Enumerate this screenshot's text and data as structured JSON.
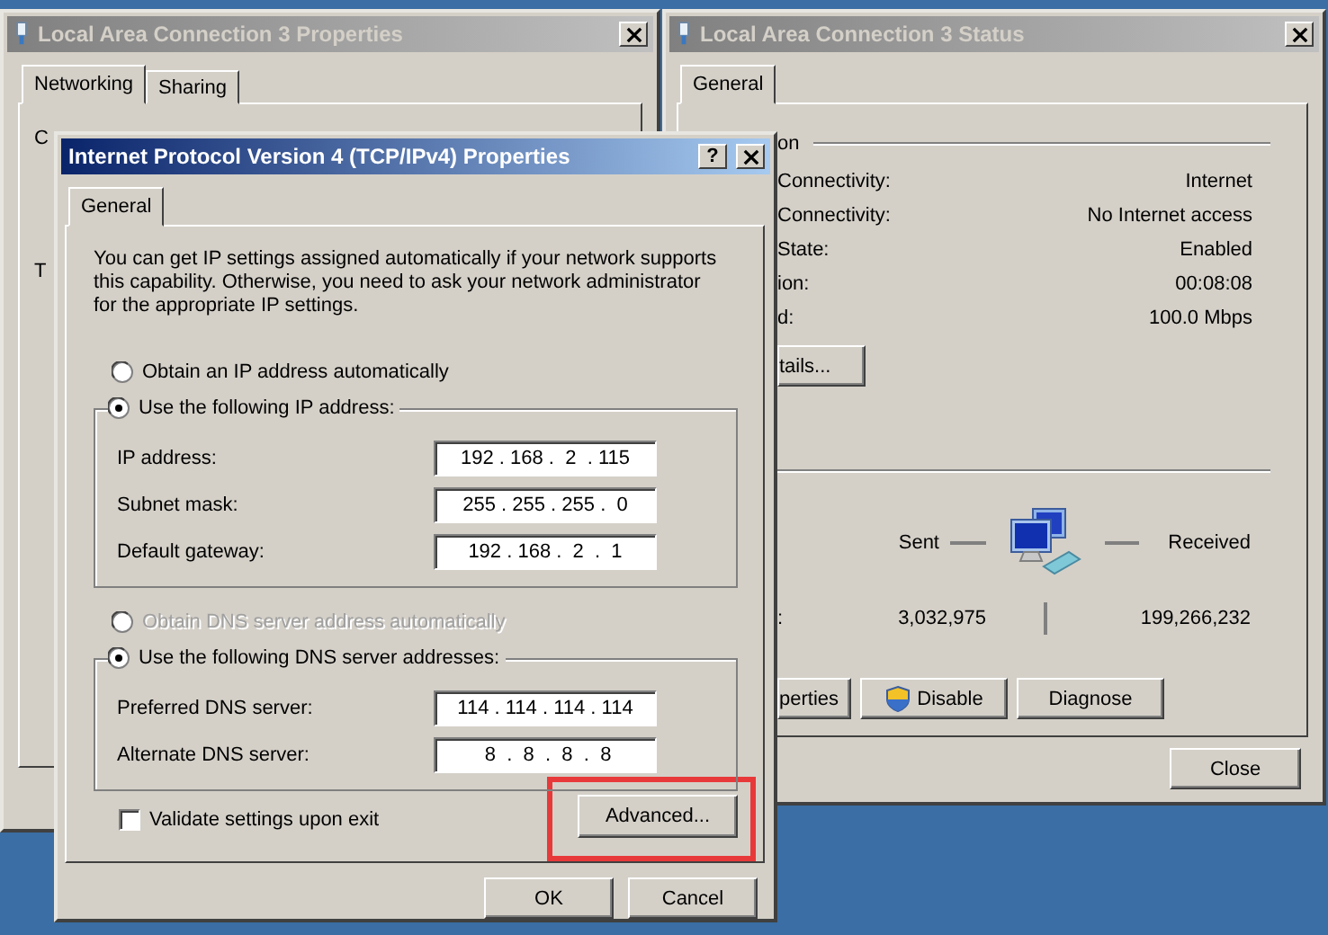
{
  "properties_window": {
    "title": "Local Area Connection 3 Properties",
    "active": false,
    "tabs": [
      {
        "label": "Networking",
        "selected": true
      },
      {
        "label": "Sharing",
        "selected": false
      }
    ],
    "fragments": [
      "C",
      "T"
    ]
  },
  "status_window": {
    "title": "Local Area Connection 3 Status",
    "active": false,
    "tabs": [
      {
        "label": "General",
        "selected": true
      }
    ],
    "section_label": "on",
    "rows": [
      {
        "label": "Connectivity:",
        "value": "Internet"
      },
      {
        "label": "Connectivity:",
        "value": "No Internet access"
      },
      {
        "label": "State:",
        "value": "Enabled"
      },
      {
        "label": "ion:",
        "value": "00:08:08"
      },
      {
        "label": "d:",
        "value": "100.0 Mbps"
      }
    ],
    "details_button": "tails...",
    "activity": {
      "sent_label": "Sent",
      "received_label": "Received",
      "bytes_label": ":",
      "sent": "3,032,975",
      "received": "199,266,232"
    },
    "buttons": [
      {
        "label": "perties",
        "kind": "plain"
      },
      {
        "label": "Disable",
        "kind": "shield"
      },
      {
        "label": "Diagnose",
        "kind": "plain"
      }
    ],
    "close_button": "Close"
  },
  "ipv4_dialog": {
    "title": "Internet Protocol Version 4 (TCP/IPv4) Properties",
    "active": true,
    "help_button": "?",
    "tabs": [
      {
        "label": "General",
        "selected": true
      }
    ],
    "intro": "You can get IP settings assigned automatically if your network supports this capability. Otherwise, you need to ask your network administrator for the appropriate IP settings.",
    "sections": [
      {
        "auto_option": {
          "label": "Obtain an IP address automatically",
          "selected": false,
          "disabled": false
        },
        "manual_option": {
          "label": "Use the following IP address:",
          "selected": true,
          "disabled": false
        },
        "fields": [
          {
            "label": "IP address:",
            "value": "192 . 168 .  2  . 115"
          },
          {
            "label": "Subnet mask:",
            "value": "255 . 255 . 255 .  0"
          },
          {
            "label": "Default gateway:",
            "value": "192 . 168 .  2  .  1"
          }
        ]
      },
      {
        "auto_option": {
          "label": "Obtain DNS server address automatically",
          "selected": false,
          "disabled": true
        },
        "manual_option": {
          "label": "Use the following DNS server addresses:",
          "selected": true,
          "disabled": false
        },
        "fields": [
          {
            "label": "Preferred DNS server:",
            "value": "114 . 114 . 114 . 114"
          },
          {
            "label": "Alternate DNS server:",
            "value": " 8  .  8  .  8  .  8"
          }
        ]
      }
    ],
    "validate": {
      "label": "Validate settings upon exit",
      "checked": false
    },
    "advanced": {
      "label": "Advanced...",
      "highlighted": true
    },
    "buttons": [
      "OK",
      "Cancel"
    ]
  }
}
